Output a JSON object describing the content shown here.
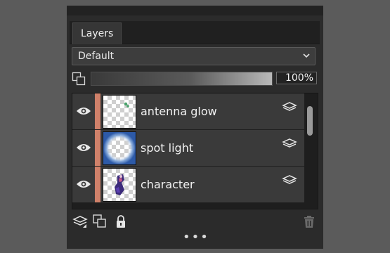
{
  "panel": {
    "tab_label": "Layers",
    "blend_mode": "Default",
    "opacity": "100%"
  },
  "layers": [
    {
      "name": "antenna glow",
      "visible": true
    },
    {
      "name": "spot light",
      "visible": true
    },
    {
      "name": "character",
      "visible": true
    }
  ],
  "footer": {
    "more_dots": "•••"
  },
  "colors": {
    "accent_strip": "#d0816a",
    "panel_bg": "#2b2b2b"
  }
}
